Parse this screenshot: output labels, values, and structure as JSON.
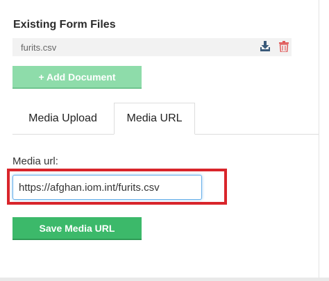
{
  "existing_files": {
    "title": "Existing Form Files",
    "files": [
      {
        "name": "furits.csv"
      }
    ]
  },
  "add_document": {
    "label": "+ Add Document"
  },
  "tabs": [
    {
      "label": "Media Upload",
      "active": false
    },
    {
      "label": "Media URL",
      "active": true
    }
  ],
  "media_url": {
    "label": "Media url:",
    "value": "https://afghan.iom.int/furits.csv"
  },
  "save_button": {
    "label": "Save Media URL"
  },
  "colors": {
    "add_button": "#8edcaa",
    "save_button": "#3cb96a",
    "highlight": "#d9252b",
    "download_icon": "#3a5a7a",
    "trash_icon": "#e05a5a"
  },
  "icons": [
    "download-icon",
    "trash-icon"
  ]
}
